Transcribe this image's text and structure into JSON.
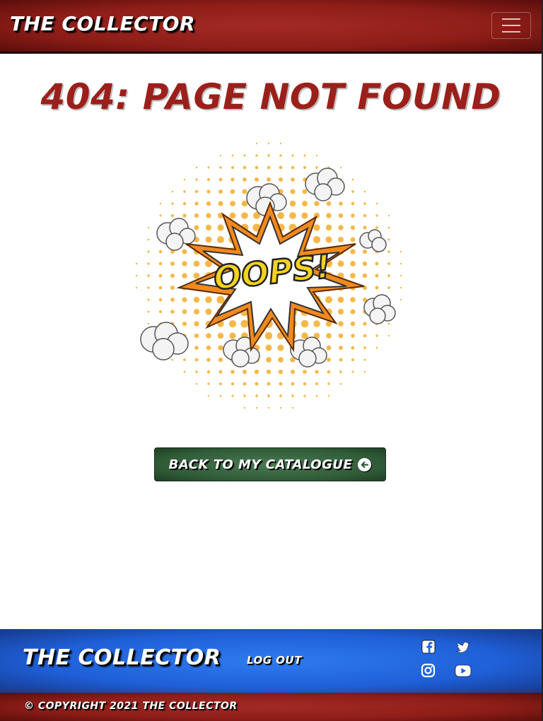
{
  "navbar": {
    "brand": "The Collector",
    "menu_icon": "hamburger-menu-icon"
  },
  "main": {
    "title": "404: Page Not Found",
    "illustration_text": "OOPS!",
    "back_button_label": "Back to My Catalogue",
    "back_button_icon": "arrow-circle-left-icon"
  },
  "footer": {
    "brand": "The Collector",
    "logout_label": "Log Out",
    "social_icons": [
      "facebook-icon",
      "twitter-icon",
      "instagram-icon",
      "youtube-icon"
    ],
    "copyright": "© Copyright 2021 The Collector"
  },
  "colors": {
    "navbar_red": "#8e1d18",
    "title_red": "#9b1f1a",
    "button_green": "#2f5a36",
    "footer_blue": "#1f5fd8"
  }
}
